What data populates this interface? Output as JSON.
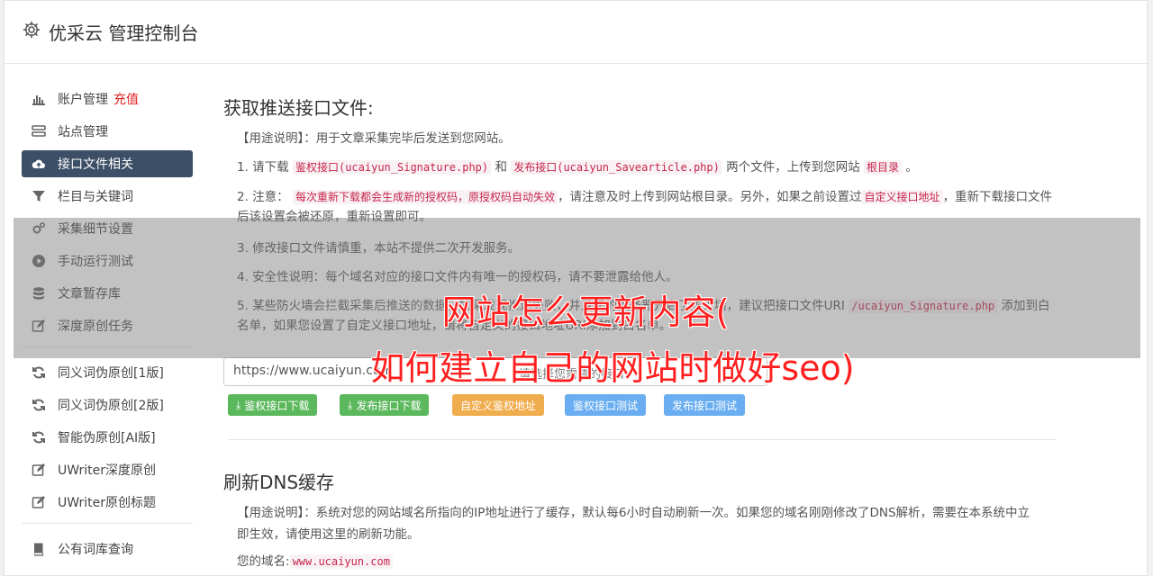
{
  "app": {
    "title": "优采云 管理控制台"
  },
  "sidebar": {
    "items": [
      {
        "label": "账户管理",
        "extra": "充值",
        "icon": "bar-chart-icon"
      },
      {
        "label": "站点管理",
        "icon": "server-icon"
      },
      {
        "label": "接口文件相关",
        "icon": "cloud-upload-icon",
        "active": true
      },
      {
        "label": "栏目与关键词",
        "icon": "filter-icon"
      },
      {
        "label": "采集细节设置",
        "icon": "cogs-icon"
      },
      {
        "label": "手动运行测试",
        "icon": "play-circle-icon"
      },
      {
        "label": "文章暂存库",
        "icon": "database-icon"
      },
      {
        "label": "深度原创任务",
        "icon": "edit-icon"
      }
    ],
    "items2": [
      {
        "label": "同义词伪原创[1版]",
        "icon": "refresh-icon"
      },
      {
        "label": "同义词伪原创[2版]",
        "icon": "refresh-icon"
      },
      {
        "label": "智能伪原创[AI版]",
        "icon": "refresh-icon"
      },
      {
        "label": "UWriter深度原创",
        "icon": "edit-icon"
      },
      {
        "label": "UWriter原创标题",
        "icon": "edit-icon"
      }
    ],
    "items3": [
      {
        "label": "公有词库查询",
        "icon": "book-icon"
      }
    ]
  },
  "section1": {
    "title": "获取推送接口文件:",
    "usage": "【用途说明】：用于文章采集完毕后发送到您网站。",
    "l1_prefix": "1. 请下载",
    "l1_code1": "鉴权接口(ucaiyun_Signature.php)",
    "l1_and": "和",
    "l1_code2": "发布接口(ucaiyun_Savearticle.php)",
    "l1_mid": "两个文件，上传到您网站",
    "l1_code3": "根目录",
    "l1_end": "。",
    "l2_prefix": "2. 注意：",
    "l2_code1": "每次重新下载都会生成新的授权码，原授权码自动失效",
    "l2_mid": "，请注意及时上传到网站根目录。另外，如果之前设置过",
    "l2_code2": "自定义接口地址",
    "l2_end": "，重新下载接口文件后该设置会被还原，重新设置即可。",
    "l3": "3. 修改接口文件请慎重，本站不提供二次开发服务。",
    "l4": "4. 安全性说明：每个域名对应的接口文件内有唯一的授权码，请不要泄露给他人。",
    "l5_prefix": "5. 某些防火墙",
    "l5_hidden": "会拦截采集后推送的数据，如果发现推送失败，并且您的",
    "l5_mid": "服务器开启了防火墙，建议把接口文件URI",
    "l5_code": "/ucaiyun_Signature.php",
    "l5_end": "添加到白名单，如果您设置了自定义接口地址，请将自定义的接口地址URI添加到白名单。",
    "url_value": "https://www.ucaiyun.com",
    "url_placeholder": "请选择您需要的接口",
    "buttons": [
      {
        "label": "鉴权接口下载",
        "style": "green",
        "icon": "download-icon"
      },
      {
        "label": "发布接口下载",
        "style": "green",
        "icon": "download-icon"
      },
      {
        "label": "自定义鉴权地址",
        "style": "orange"
      },
      {
        "label": "鉴权接口测试",
        "style": "blue"
      },
      {
        "label": "发布接口测试",
        "style": "blue"
      }
    ]
  },
  "section2": {
    "title": "刷新DNS缓存",
    "usage": "【用途说明】：系统对您的网站域名所指向的IP地址进行了缓存，默认每6小时自动刷新一次。如果您的域名刚刚修改了DNS解析，需要在本系统中立即生效，请使用这里的刷新功能。",
    "domain_label": "您的域名:",
    "domain_value": "www.ucaiyun.com"
  },
  "overlay": {
    "line1": "网站怎么更新内容(",
    "line2": "如何建立自己的网站时做好seo)"
  },
  "colors": {
    "active_nav": "#3d4f66",
    "accent_red": "#e02020",
    "overlay_text": "#ff1f1f"
  }
}
